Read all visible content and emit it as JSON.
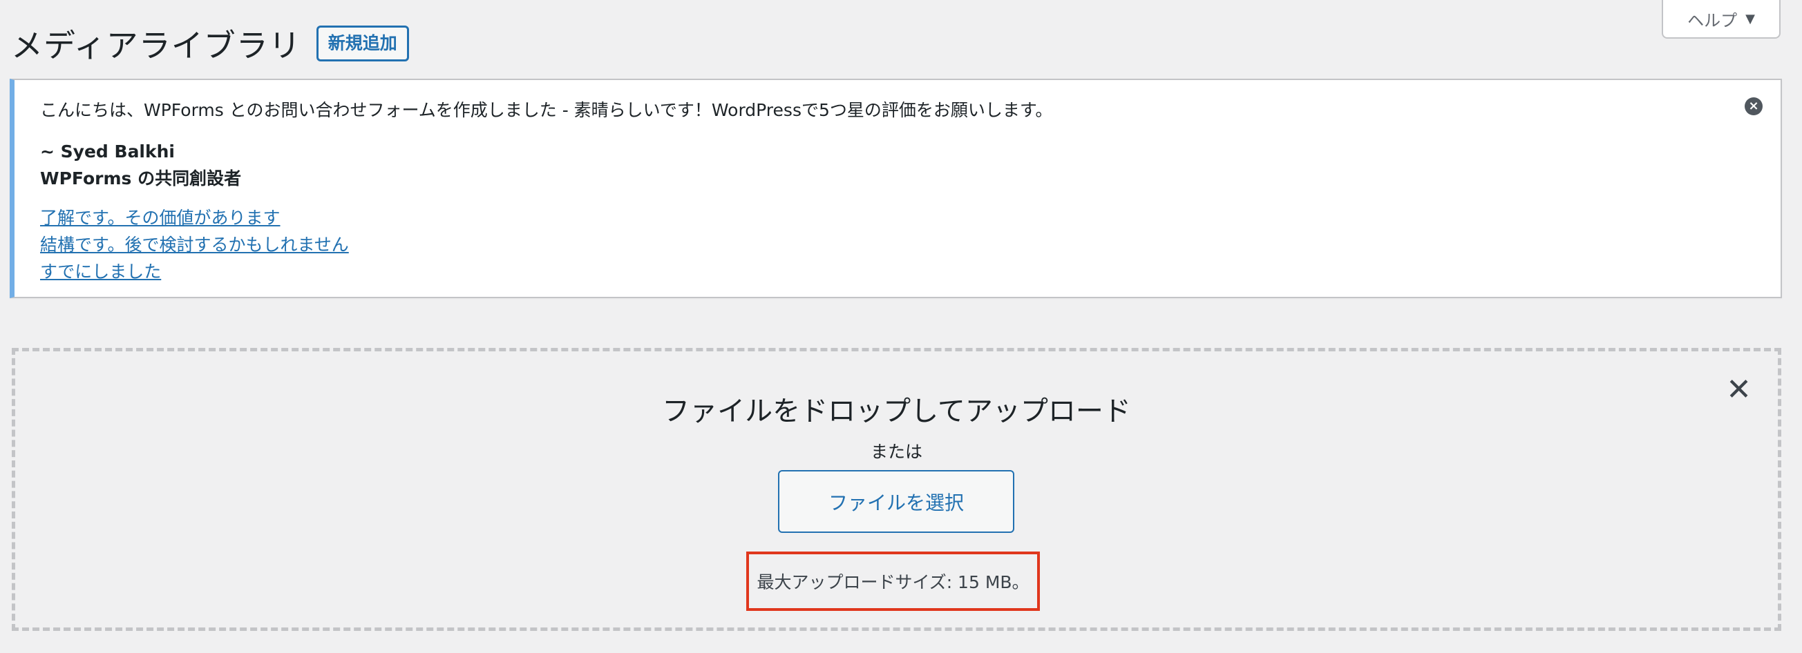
{
  "header": {
    "help_label": "ヘルプ",
    "title": "メディアライブラリ",
    "add_new_label": "新規追加"
  },
  "notice": {
    "message": "こんにちは、WPForms とのお問い合わせフォームを作成しました - 素晴らしいです！WordPressで5つ星の評価をお願いします。",
    "signature_name": "~ Syed Balkhi",
    "signature_role": "WPForms の共同創設者",
    "links": [
      "了解です。その価値があります",
      "結構です。後で検討するかもしれません",
      "すでにしました"
    ],
    "dismiss_icon": "×"
  },
  "uploader": {
    "close_icon": "✕",
    "drop_title": "ファイルをドロップしてアップロード",
    "or_label": "または",
    "select_button": "ファイルを選択",
    "max_size_text": "最大アップロードサイズ: 15 MB。"
  },
  "colors": {
    "accent": "#2271b1",
    "notice_border": "#72aee6",
    "highlight": "#e0371d"
  }
}
